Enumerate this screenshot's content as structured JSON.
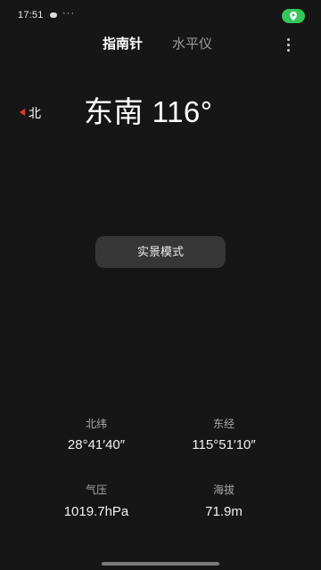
{
  "status_bar": {
    "time": "17:51",
    "more_indicator": "···"
  },
  "tabs": [
    {
      "label": "指南针",
      "active": true
    },
    {
      "label": "水平仪",
      "active": false
    }
  ],
  "compass": {
    "north_label": "北",
    "heading_text": "东南 116°"
  },
  "ar_mode_button": {
    "label": "实景模式"
  },
  "info": {
    "latitude": {
      "label": "北纬",
      "value": "28°41′40″"
    },
    "longitude": {
      "label": "东经",
      "value": "115°51′10″"
    },
    "pressure": {
      "label": "气压",
      "value": "1019.7hPa"
    },
    "altitude": {
      "label": "海拔",
      "value": "71.9m"
    }
  },
  "colors": {
    "background": "#161616",
    "location_pill": "#34c759",
    "north_arrow": "#e53935",
    "button_bg": "#363636"
  }
}
